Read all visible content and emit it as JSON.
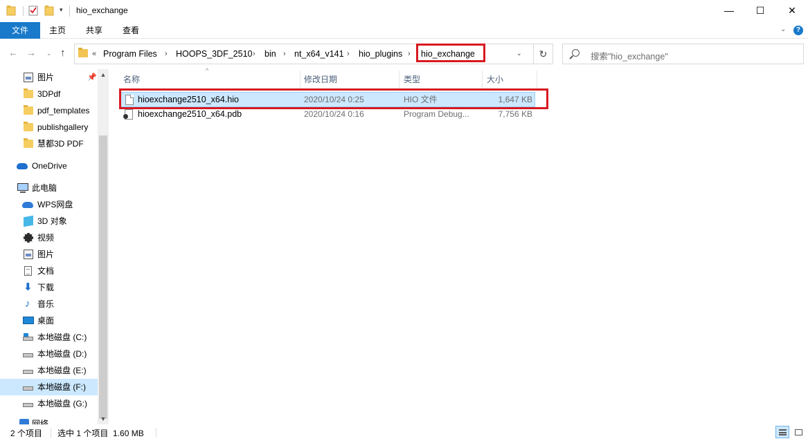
{
  "window": {
    "title": "hio_exchange",
    "minimize_glyph": "—",
    "maximize_glyph": "☐",
    "close_glyph": "✕"
  },
  "quick_access": {
    "dropdown_glyph": "▾"
  },
  "ribbon": {
    "tabs": [
      {
        "label": "文件"
      },
      {
        "label": "主页"
      },
      {
        "label": "共享"
      },
      {
        "label": "查看"
      }
    ],
    "expand_glyph": "⌄",
    "help_glyph": "?"
  },
  "nav": {
    "back_glyph": "←",
    "forward_glyph": "→",
    "recent_glyph": "⌄",
    "up_glyph": "↑",
    "refresh_glyph": "↻",
    "address_dropdown_glyph": "⌄",
    "overflow_glyph": "«",
    "chevron_glyph": "›",
    "breadcrumbs": [
      "Program Files",
      "HOOPS_3DF_2510",
      "bin",
      "nt_x64_v141",
      "hio_plugins",
      "hio_exchange"
    ],
    "search_placeholder": "搜索\"hio_exchange\""
  },
  "sidebar": {
    "pin_glyph": "📌",
    "items": [
      {
        "label": "图片",
        "icon": "pictures-icon",
        "pinned": true
      },
      {
        "label": "3DPdf",
        "icon": "folder-icon"
      },
      {
        "label": "pdf_templates",
        "icon": "folder-icon"
      },
      {
        "label": "publishgallery",
        "icon": "folder-icon"
      },
      {
        "label": "慧都3D PDF",
        "icon": "folder-icon"
      },
      {
        "label": "OneDrive",
        "icon": "onedrive-icon"
      },
      {
        "label": "此电脑",
        "icon": "this-pc-icon"
      },
      {
        "label": "WPS网盘",
        "icon": "wps-cloud-icon"
      },
      {
        "label": "3D 对象",
        "icon": "3d-objects-icon"
      },
      {
        "label": "视频",
        "icon": "videos-icon"
      },
      {
        "label": "图片",
        "icon": "pictures-icon"
      },
      {
        "label": "文档",
        "icon": "documents-icon"
      },
      {
        "label": "下载",
        "icon": "downloads-icon"
      },
      {
        "label": "音乐",
        "icon": "music-icon"
      },
      {
        "label": "桌面",
        "icon": "desktop-icon"
      },
      {
        "label": "本地磁盘 (C:)",
        "icon": "system-drive-icon"
      },
      {
        "label": "本地磁盘 (D:)",
        "icon": "drive-icon"
      },
      {
        "label": "本地磁盘 (E:)",
        "icon": "drive-icon"
      },
      {
        "label": "本地磁盘 (F:)",
        "icon": "drive-icon",
        "selected": true
      },
      {
        "label": "本地磁盘 (G:)",
        "icon": "drive-icon"
      },
      {
        "label": "网络",
        "icon": "network-icon"
      }
    ],
    "scroll_up_glyph": "▲",
    "scroll_down_glyph": "▼"
  },
  "file_list": {
    "sort_glyph": "^",
    "columns": [
      "名称",
      "修改日期",
      "类型",
      "大小"
    ],
    "rows": [
      {
        "name": "hioexchange2510_x64.hio",
        "modified": "2020/10/24 0:25",
        "type": "HIO 文件",
        "size": "1,647 KB",
        "selected": true,
        "icon": "file-icon"
      },
      {
        "name": "hioexchange2510_x64.pdb",
        "modified": "2020/10/24 0:16",
        "type": "Program Debug...",
        "size": "7,756 KB",
        "selected": false,
        "icon": "pdb-file-icon"
      }
    ]
  },
  "status": {
    "item_count": "2 个项目",
    "selection": "选中 1 个项目  1.60 MB"
  },
  "colors": {
    "accent": "#1979ca",
    "selection": "#cce8ff",
    "highlight_box": "#d71920"
  }
}
